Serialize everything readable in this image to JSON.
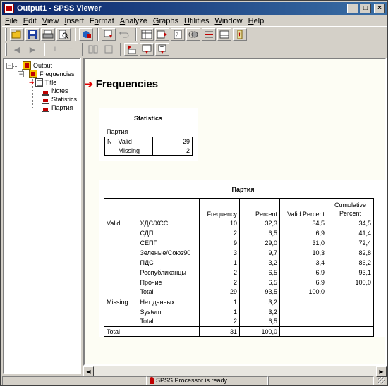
{
  "window": {
    "title": "Output1 - SPSS Viewer",
    "minimize": "_",
    "maximize": "□",
    "close": "×"
  },
  "menu": [
    {
      "acc": "F",
      "rest": "ile"
    },
    {
      "acc": "E",
      "rest": "dit"
    },
    {
      "acc": "V",
      "rest": "iew"
    },
    {
      "acc": "I",
      "rest": "nsert"
    },
    {
      "acc": "",
      "rest": "Format",
      "accIndex": 1
    },
    {
      "acc": "A",
      "rest": "nalyze"
    },
    {
      "acc": "G",
      "rest": "raphs"
    },
    {
      "acc": "U",
      "rest": "tilities"
    },
    {
      "acc": "W",
      "rest": "indow"
    },
    {
      "acc": "H",
      "rest": "elp"
    }
  ],
  "menu_labels": [
    "File",
    "Edit",
    "View",
    "Insert",
    "Format",
    "Analyze",
    "Graphs",
    "Utilities",
    "Window",
    "Help"
  ],
  "outline": {
    "root": "Output",
    "child": "Frequencies",
    "items": [
      "Title",
      "Notes",
      "Statistics",
      "Партия"
    ]
  },
  "content": {
    "heading": "Frequencies",
    "statistics": {
      "title": "Statistics",
      "variable": "Партия",
      "n_label": "N",
      "rows": [
        {
          "label": "Valid",
          "value": "29"
        },
        {
          "label": "Missing",
          "value": "2"
        }
      ]
    },
    "frequency_table": {
      "title": "Партия",
      "headers": [
        "Frequency",
        "Percent",
        "Valid Percent",
        "Cumulative Percent"
      ],
      "header_cumulative_line1": "Cumulative",
      "header_cumulative_line2": "Percent",
      "rows": [
        {
          "group": "Valid",
          "label": "ХДС/ХСС",
          "freq": "10",
          "pct": "32,3",
          "vpct": "34,5",
          "cpct": "34,5"
        },
        {
          "group": "",
          "label": "СДП",
          "freq": "2",
          "pct": "6,5",
          "vpct": "6,9",
          "cpct": "41,4"
        },
        {
          "group": "",
          "label": "СЕПГ",
          "freq": "9",
          "pct": "29,0",
          "vpct": "31,0",
          "cpct": "72,4"
        },
        {
          "group": "",
          "label": "Зеленые/Союз90",
          "freq": "3",
          "pct": "9,7",
          "vpct": "10,3",
          "cpct": "82,8"
        },
        {
          "group": "",
          "label": "ПДС",
          "freq": "1",
          "pct": "3,2",
          "vpct": "3,4",
          "cpct": "86,2"
        },
        {
          "group": "",
          "label": "Республиканцы",
          "freq": "2",
          "pct": "6,5",
          "vpct": "6,9",
          "cpct": "93,1"
        },
        {
          "group": "",
          "label": "Прочие",
          "freq": "2",
          "pct": "6,5",
          "vpct": "6,9",
          "cpct": "100,0"
        },
        {
          "group": "",
          "label": "Total",
          "freq": "29",
          "pct": "93,5",
          "vpct": "100,0",
          "cpct": ""
        },
        {
          "group": "Missing",
          "label": "Нет данных",
          "freq": "1",
          "pct": "3,2",
          "vpct": "",
          "cpct": ""
        },
        {
          "group": "",
          "label": "System",
          "freq": "1",
          "pct": "3,2",
          "vpct": "",
          "cpct": ""
        },
        {
          "group": "",
          "label": "Total",
          "freq": "2",
          "pct": "6,5",
          "vpct": "",
          "cpct": ""
        },
        {
          "group": "Total",
          "label": "",
          "freq": "31",
          "pct": "100,0",
          "vpct": "",
          "cpct": ""
        }
      ]
    }
  },
  "status": {
    "message": "SPSS Processor  is ready"
  },
  "colors": {
    "titlebar_start": "#0a246a",
    "titlebar_end": "#3a6ea5",
    "arrow": "#e00000",
    "pane_bg": "#fdfdf4"
  }
}
